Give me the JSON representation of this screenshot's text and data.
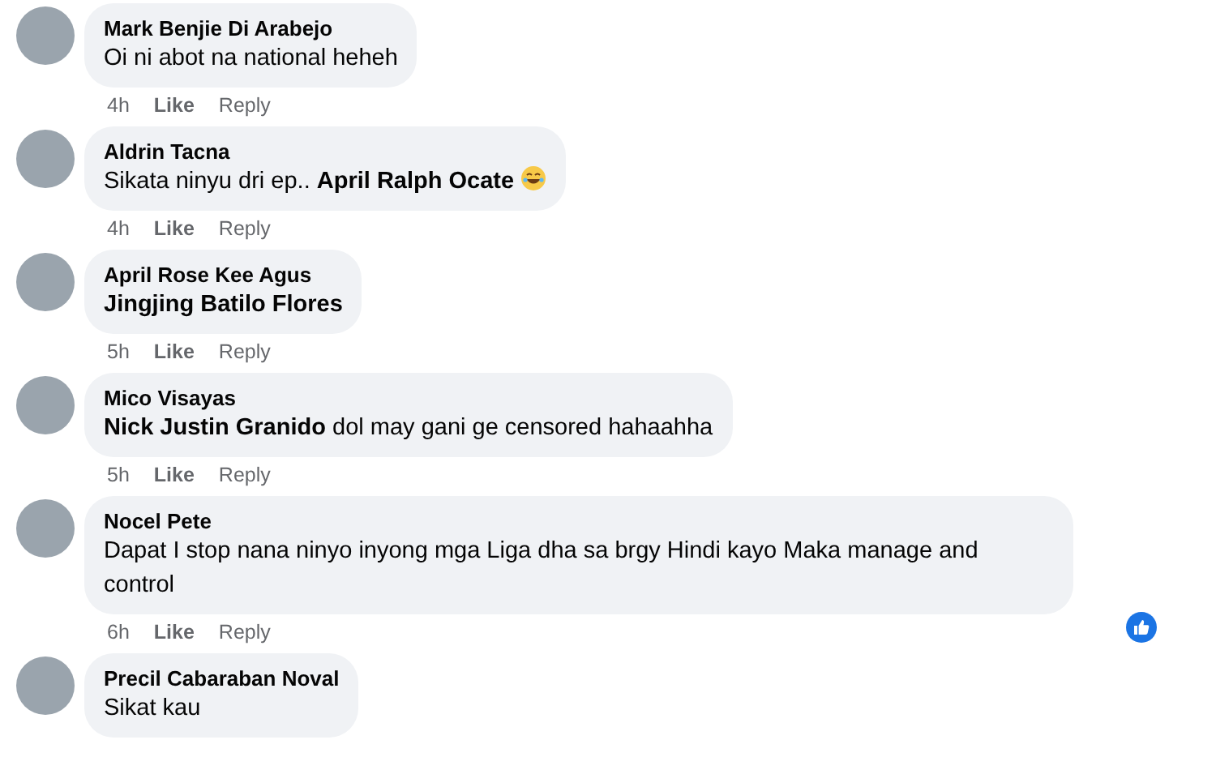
{
  "comments": [
    {
      "author": "Mark Benjie Di Arabejo",
      "text": "Oi ni abot na national heheh",
      "text_bold": false,
      "time": "4h",
      "like": "Like",
      "reply": "Reply"
    },
    {
      "author": "Aldrin Tacna",
      "text": "Sikata ninyu dri ep.. **April Ralph Ocate**",
      "text_bold": false,
      "trailing_emoji": {
        "kind": "laughing"
      },
      "time": "4h",
      "like": "Like",
      "reply": "Reply"
    },
    {
      "author": "April Rose Kee Agus",
      "text": "Jingjing Batilo Flores",
      "text_bold": true,
      "time": "5h",
      "like": "Like",
      "reply": "Reply"
    },
    {
      "author": "Mico Visayas",
      "text": "**Nick Justin Granido** dol may gani ge censored hahaahha",
      "text_bold": false,
      "time": "5h",
      "like": "Like",
      "reply": "Reply"
    },
    {
      "author": "Nocel Pete",
      "text": "Dapat I stop nana ninyo inyong mga Liga dha sa brgy Hindi kayo Maka manage and control",
      "text_bold": false,
      "reaction": {
        "kind": "like"
      },
      "time": "6h",
      "like": "Like",
      "reply": "Reply"
    },
    {
      "author": "Precil Cabaraban Noval",
      "text": "Sikat kau",
      "text_bold": false
    }
  ]
}
